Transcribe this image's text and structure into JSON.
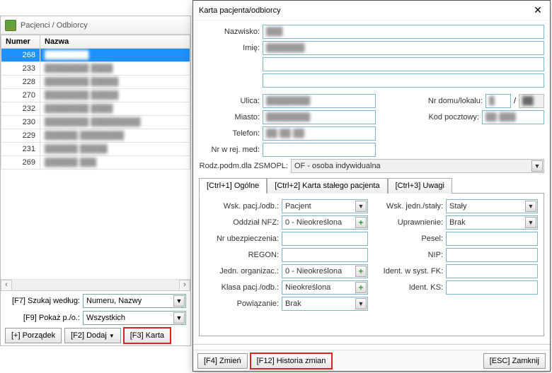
{
  "main": {
    "title": "Pacjenci / Odbiorcy",
    "columns": {
      "number": "Numer",
      "name": "Nazwa"
    },
    "rows": [
      {
        "num": 268,
        "name": "████████",
        "selected": true
      },
      {
        "num": 233,
        "name": "████████ ████",
        "selected": false
      },
      {
        "num": 228,
        "name": "████████ █████",
        "selected": false
      },
      {
        "num": 270,
        "name": "████████ █████",
        "selected": false
      },
      {
        "num": 232,
        "name": "████████ ████",
        "selected": false
      },
      {
        "num": 230,
        "name": "████████ █████████",
        "selected": false
      },
      {
        "num": 229,
        "name": "██████ ████████",
        "selected": false
      },
      {
        "num": 231,
        "name": "██████ █████",
        "selected": false
      },
      {
        "num": 269,
        "name": "██████ ███",
        "selected": false
      }
    ],
    "search_label": "[F7] Szukaj według:",
    "search_value": "Numeru, Nazwy",
    "show_label": "[F9] Pokaż p./o.:",
    "show_value": "Wszystkich",
    "btn_order": "[+] Porządek",
    "btn_add": "[F2] Dodaj",
    "btn_card": "[F3] Karta"
  },
  "dialog": {
    "title": "Karta pacjenta/odbiorcy",
    "labels": {
      "nazwisko": "Nazwisko:",
      "imie": "Imię:",
      "ulica": "Ulica:",
      "nr_domu": "Nr domu/lokalu:",
      "miasto": "Miasto:",
      "kod": "Kod pocztowy:",
      "telefon": "Telefon:",
      "nr_rej": "Nr w rej. med:",
      "rodz_podm": "Rodz.podm.dla ZSMOPL:"
    },
    "values": {
      "nazwisko": "███",
      "imie": "███████",
      "ulica": "████████",
      "nr_domu_a": "█",
      "nr_domu_b": "██",
      "miasto": "████████",
      "kod": "██-███",
      "telefon": "██-██-██",
      "nr_rej": "",
      "rodz_podm": "OF - osoba indywidualna"
    },
    "slash": "/",
    "tabs": {
      "t1": "[Ctrl+1] Ogólne",
      "t2": "[Ctrl+2] Karta stałego pacjenta",
      "t3": "[Ctrl+3] Uwagi"
    },
    "panel": {
      "wsk_pac_l": "Wsk. pacj./odb.:",
      "wsk_pac_v": "Pacjent",
      "nfz_l": "Oddział NFZ:",
      "nfz_v": "0 - Nieokreślona",
      "ubezp_l": "Nr ubezpieczenia:",
      "ubezp_v": "",
      "regon_l": "REGON:",
      "regon_v": "",
      "jedn_l": "Jedn. organizac.:",
      "jedn_v": "0 - Nieokreślona",
      "klasa_l": "Klasa pacj./odb.:",
      "klasa_v": "Nieokreślona",
      "pow_l": "Powiązanie:",
      "pow_v": "Brak",
      "wsk_js_l": "Wsk. jedn./stały:",
      "wsk_js_v": "Stały",
      "upr_l": "Uprawnienie:",
      "upr_v": "Brak",
      "pesel_l": "Pesel:",
      "pesel_v": "",
      "nip_l": "NIP:",
      "nip_v": "",
      "ident_fk_l": "Ident. w syst. FK:",
      "ident_fk_v": "",
      "ident_ks_l": "Ident. KS:",
      "ident_ks_v": ""
    },
    "btn_change": "[F4] Zmień",
    "btn_history": "[F12] Historia zmian",
    "btn_close": "[ESC] Zamknij"
  }
}
